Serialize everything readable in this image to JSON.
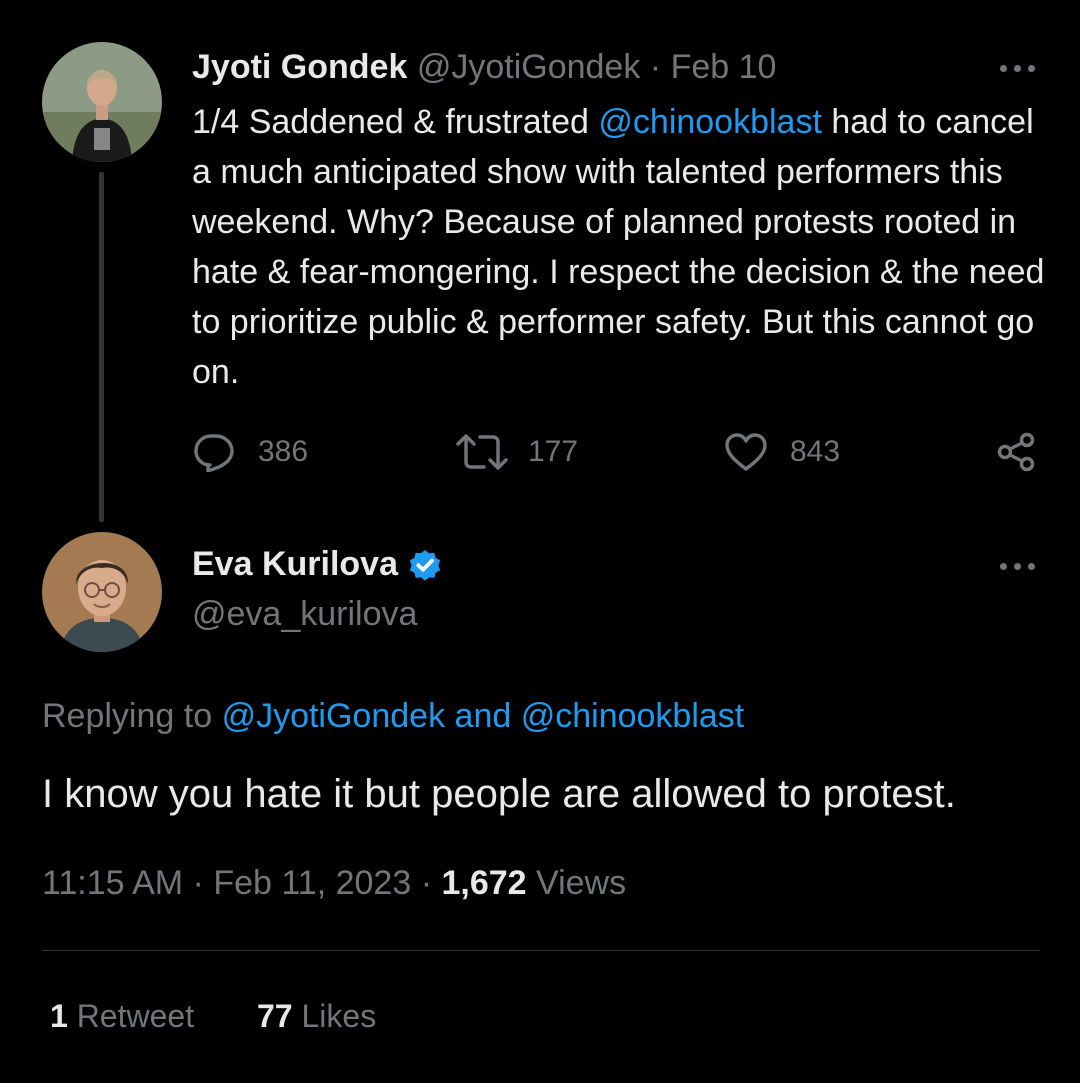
{
  "parent_tweet": {
    "author_name": "Jyoti Gondek",
    "author_handle": "@JyotiGondek",
    "separator": "·",
    "date": "Feb 10",
    "text_part1": "1/4 Saddened & frustrated ",
    "mention": "@chinookblast",
    "text_part2": " had to cancel a much anticipated show with talented performers this weekend. Why? Because of planned protests rooted in hate & fear-mongering. I respect the decision & the need to prioritize public & performer safety. But this cannot go on.",
    "replies": "386",
    "retweets": "177",
    "likes": "843"
  },
  "reply_tweet": {
    "author_name": "Eva Kurilova",
    "author_handle": "@eva_kurilova",
    "replying_to_label": "Replying to",
    "replying_to_user1": "@JyotiGondek",
    "replying_to_and": "and",
    "replying_to_user2": "@chinookblast",
    "text": "I know you hate it but people are allowed to protest.",
    "time": "11:15 AM",
    "date": "Feb 11, 2023",
    "views_count": "1,672",
    "views_label": "Views",
    "retweet_count": "1",
    "retweet_label": "Retweet",
    "like_count": "77",
    "like_label": "Likes"
  },
  "icons": {
    "reply": "reply-icon",
    "retweet": "retweet-icon",
    "like": "heart-icon",
    "share": "share-icon",
    "more": "more-icon",
    "verified": "verified-badge-icon"
  },
  "colors": {
    "background": "#000000",
    "text": "#e7e9ea",
    "muted": "#71767b",
    "accent": "#1d9bf0"
  }
}
